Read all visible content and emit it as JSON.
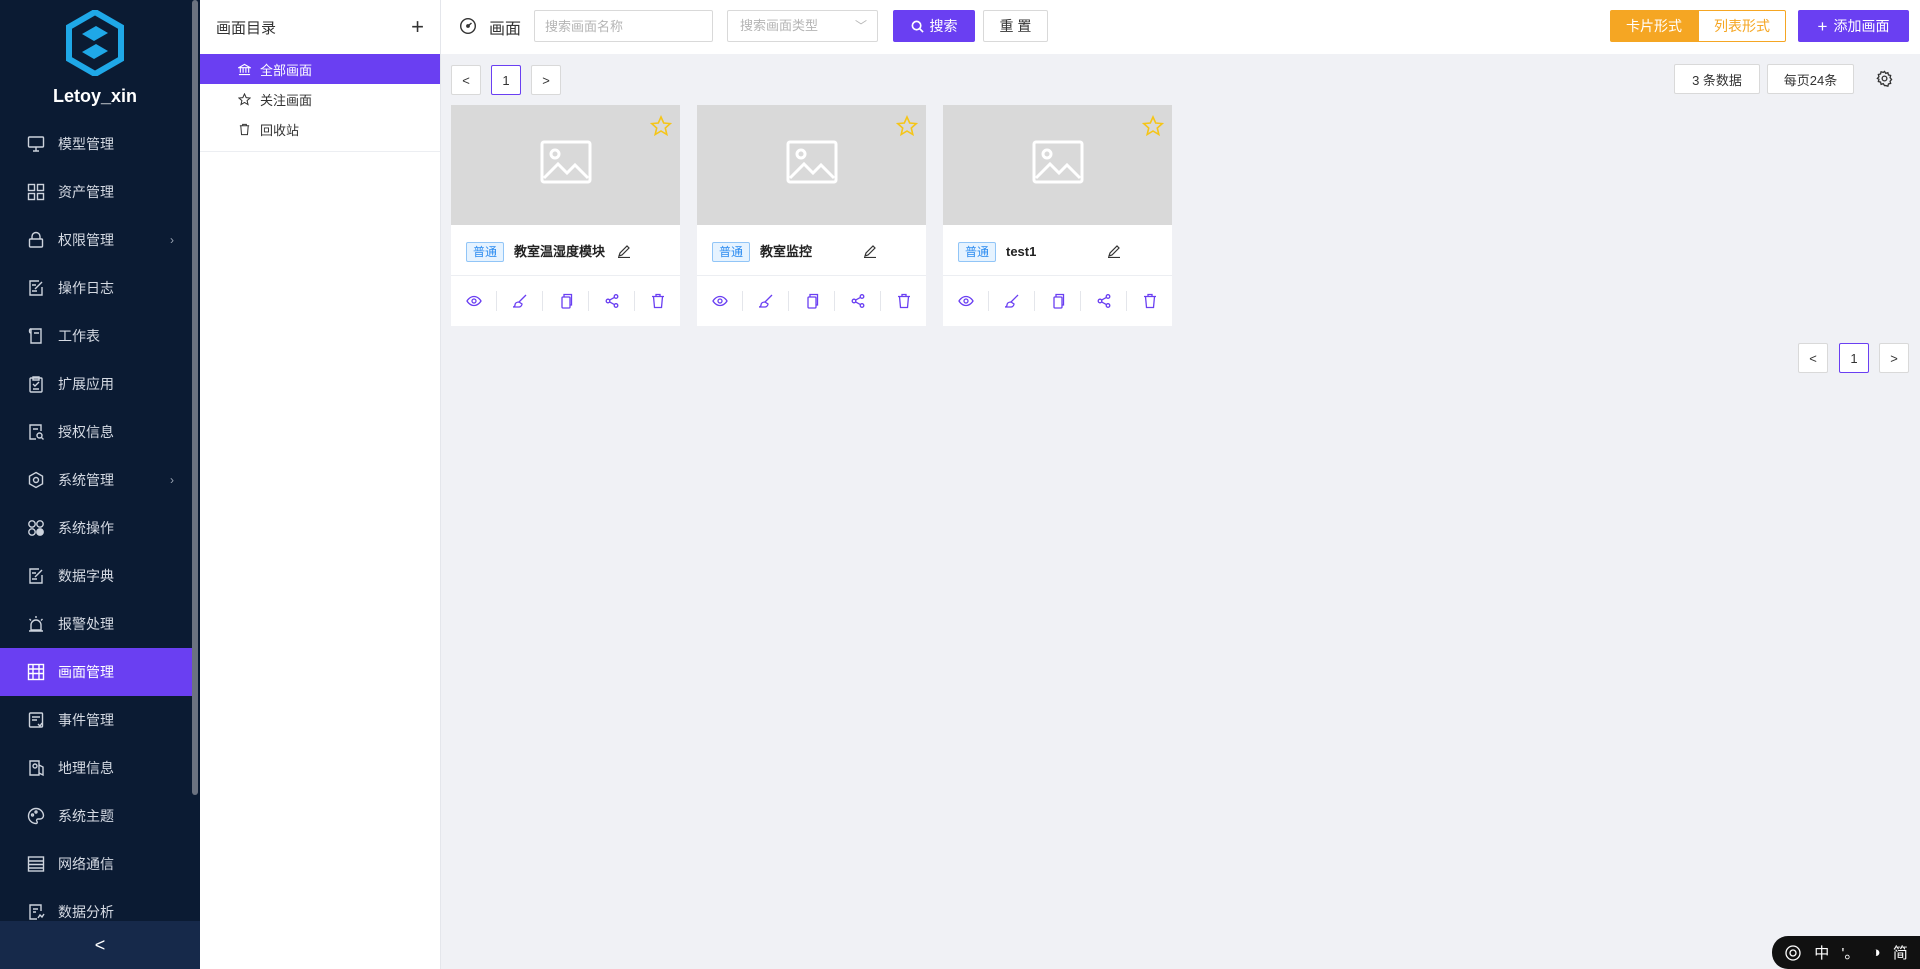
{
  "app": {
    "name": "Letoy_xin"
  },
  "sidebar": {
    "items": [
      {
        "label": "模型管理",
        "icon": "monitor-icon",
        "arrow": false,
        "active": false
      },
      {
        "label": "资产管理",
        "icon": "grid-icon",
        "arrow": false,
        "active": false
      },
      {
        "label": "权限管理",
        "icon": "lock-icon",
        "arrow": true,
        "active": false
      },
      {
        "label": "操作日志",
        "icon": "edit-doc-icon",
        "arrow": false,
        "active": false
      },
      {
        "label": "工作表",
        "icon": "sheet-icon",
        "arrow": false,
        "active": false
      },
      {
        "label": "扩展应用",
        "icon": "clipboard-check-icon",
        "arrow": false,
        "active": false
      },
      {
        "label": "授权信息",
        "icon": "search-doc-icon",
        "arrow": false,
        "active": false
      },
      {
        "label": "系统管理",
        "icon": "gear-icon",
        "arrow": true,
        "active": false
      },
      {
        "label": "系统操作",
        "icon": "apps-icon",
        "arrow": false,
        "active": false
      },
      {
        "label": "数据字典",
        "icon": "edit-doc-icon",
        "arrow": false,
        "active": false
      },
      {
        "label": "报警处理",
        "icon": "alarm-icon",
        "arrow": false,
        "active": false
      },
      {
        "label": "画面管理",
        "icon": "screen-grid-icon",
        "arrow": false,
        "active": true
      },
      {
        "label": "事件管理",
        "icon": "event-icon",
        "arrow": false,
        "active": false
      },
      {
        "label": "地理信息",
        "icon": "map-icon",
        "arrow": false,
        "active": false
      },
      {
        "label": "系统主题",
        "icon": "palette-icon",
        "arrow": false,
        "active": false
      },
      {
        "label": "网络通信",
        "icon": "list-icon",
        "arrow": false,
        "active": false
      },
      {
        "label": "数据分析",
        "icon": "analysis-icon",
        "arrow": false,
        "active": false
      }
    ],
    "collapse_label": "<"
  },
  "directory": {
    "title": "画面目录",
    "add_label": "+",
    "items": [
      {
        "label": "全部画面",
        "icon": "bank-icon"
      },
      {
        "label": "关注画面",
        "icon": "star-icon"
      },
      {
        "label": "回收站",
        "icon": "trash-icon"
      }
    ]
  },
  "toolbar": {
    "title": "画面",
    "search_placeholder": "搜索画面名称",
    "type_placeholder": "搜索画面类型",
    "search_label": "搜索",
    "reset_label": "重 置",
    "card_view_label": "卡片形式",
    "list_view_label": "列表形式",
    "add_label": "添加画面"
  },
  "pagination": {
    "current_page": "1",
    "prev": "<",
    "next": ">",
    "total_label": "3 条数据",
    "page_size_label": "每页24条"
  },
  "cards": [
    {
      "tag": "普通",
      "name": "教室温湿度模块"
    },
    {
      "tag": "普通",
      "name": "教室监控"
    },
    {
      "tag": "普通",
      "name": "test1"
    }
  ],
  "ime": {
    "mode": "中",
    "punct": "'。",
    "variant": "简"
  },
  "colors": {
    "primary": "#6a3ff2",
    "sidebar_bg": "#0b1b33",
    "orange": "#f5a623",
    "star": "#f5c518"
  }
}
